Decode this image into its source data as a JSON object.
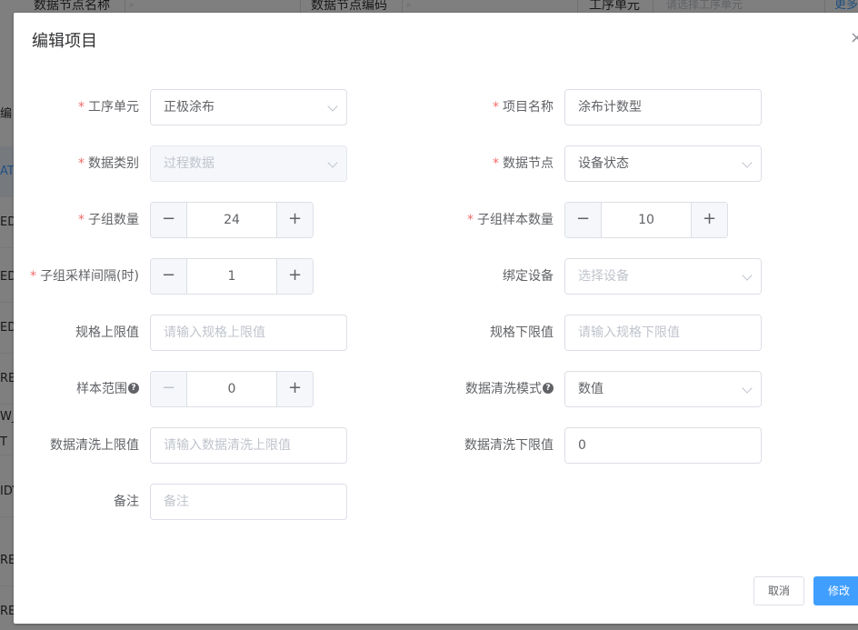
{
  "background": {
    "filters": [
      {
        "label": "数据节点名称"
      },
      {
        "label": "数据节点编码"
      },
      {
        "label": "工序单元",
        "placeholder": "请选择工序单元"
      }
    ],
    "more_label": "更多",
    "left_rows": [
      "编",
      "AT",
      "ED",
      "ED",
      "ED",
      "RE",
      "W_",
      "T",
      "IDY",
      "RE",
      "RE"
    ]
  },
  "dialog": {
    "title": "编辑项目",
    "close_glyph": "×",
    "fields": {
      "process_unit": {
        "label": "工序单元",
        "value": "正极涂布"
      },
      "item_name": {
        "label": "项目名称",
        "value": "涂布计数型"
      },
      "data_category": {
        "label": "数据类别",
        "value": "过程数据"
      },
      "data_node": {
        "label": "数据节点",
        "value": "设备状态"
      },
      "subgroup_count": {
        "label": "子组数量",
        "value": "24"
      },
      "subgroup_sample_count": {
        "label": "子组样本数量",
        "value": "10"
      },
      "subgroup_interval": {
        "label": "子组采样间隔(时)",
        "value": "1"
      },
      "bind_device": {
        "label": "绑定设备",
        "placeholder": "选择设备"
      },
      "spec_upper": {
        "label": "规格上限值",
        "placeholder": "请输入规格上限值"
      },
      "spec_lower": {
        "label": "规格下限值",
        "placeholder": "请输入规格下限值"
      },
      "sample_range": {
        "label": "样本范围",
        "value": "0"
      },
      "clean_mode": {
        "label": "数据清洗模式",
        "value": "数值"
      },
      "clean_upper": {
        "label": "数据清洗上限值",
        "placeholder": "请输入数据清洗上限值"
      },
      "clean_lower": {
        "label": "数据清洗下限值",
        "value": "0"
      },
      "remark": {
        "label": "备注",
        "placeholder": "备注"
      }
    },
    "required_mark": "*",
    "help_glyph": "?",
    "minus_glyph": "−",
    "plus_glyph": "+",
    "buttons": {
      "cancel": "取消",
      "submit": "修改"
    }
  },
  "colors": {
    "primary": "#409eff",
    "required": "#f56c6c",
    "border": "#dcdfe6",
    "mask": "rgba(0,0,0,0.5)"
  }
}
